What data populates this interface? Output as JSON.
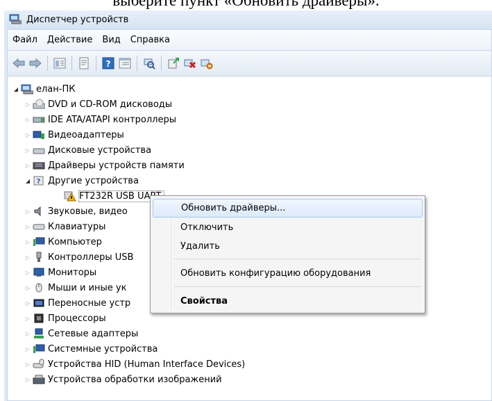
{
  "caption": "выберите пункт «Обновить драйверы».",
  "window": {
    "title": "Диспетчер устройств"
  },
  "menubar": {
    "items": [
      "Файл",
      "Действие",
      "Вид",
      "Справка"
    ]
  },
  "tree": {
    "root": "елан-ПК",
    "items": [
      {
        "label": "DVD и CD-ROM дисководы",
        "icon": "optical-drive-icon"
      },
      {
        "label": "IDE ATA/ATAPI контроллеры",
        "icon": "ide-controller-icon"
      },
      {
        "label": "Видеоадаптеры",
        "icon": "display-adapter-icon"
      },
      {
        "label": "Дисковые устройства",
        "icon": "disk-drive-icon"
      },
      {
        "label": "Драйверы устройств памяти",
        "icon": "memory-icon"
      },
      {
        "label": "Другие устройства",
        "icon": "other-devices-icon"
      },
      {
        "label": "FT232R USB UART",
        "icon": "warning-device-icon"
      },
      {
        "label": "Звуковые, видео",
        "icon": "sound-icon"
      },
      {
        "label": "Клавиатуры",
        "icon": "keyboard-icon"
      },
      {
        "label": "Компьютер",
        "icon": "computer-icon"
      },
      {
        "label": "Контроллеры USB",
        "icon": "usb-icon"
      },
      {
        "label": "Мониторы",
        "icon": "monitor-icon"
      },
      {
        "label": "Мыши и иные ук",
        "icon": "mouse-icon"
      },
      {
        "label": "Переносные устр",
        "icon": "portable-device-icon"
      },
      {
        "label": "Процессоры",
        "icon": "processor-icon"
      },
      {
        "label": "Сетевые адаптеры",
        "icon": "network-adapter-icon"
      },
      {
        "label": "Системные устройства",
        "icon": "system-device-icon"
      },
      {
        "label": "Устройства HID (Human Interface Devices)",
        "icon": "hid-icon"
      },
      {
        "label": "Устройства обработки изображений",
        "icon": "imaging-device-icon"
      }
    ]
  },
  "context_menu": {
    "update_drivers": "Обновить драйверы...",
    "disable": "Отключить",
    "uninstall": "Удалить",
    "scan": "Обновить конфигурацию оборудования",
    "properties": "Свойства"
  },
  "colors": {
    "window_frame": "#dde9f6",
    "hover_fill": "#dceafb",
    "hover_border": "#a8c8ee",
    "warning": "#f2b10f"
  }
}
